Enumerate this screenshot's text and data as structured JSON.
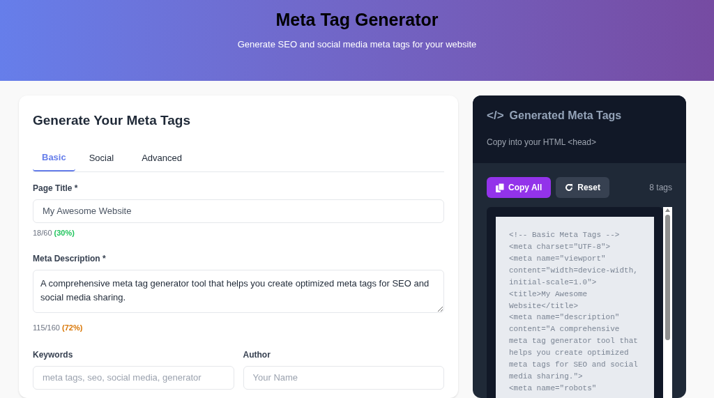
{
  "header": {
    "title": "Meta Tag Generator",
    "subtitle": "Generate SEO and social media meta tags for your website"
  },
  "form": {
    "title": "Generate Your Meta Tags",
    "tabs": [
      {
        "label": "Basic",
        "selected": true
      },
      {
        "label": "Social",
        "selected": false
      },
      {
        "label": "Advanced",
        "selected": false
      }
    ],
    "page_title": {
      "label": "Page Title *",
      "value": "My Awesome Website",
      "count": "18/60",
      "percent": "(30%)",
      "color": "#22c55e"
    },
    "meta_description": {
      "label": "Meta Description *",
      "value": "A comprehensive meta tag generator tool that helps you create optimized meta tags for SEO and social media sharing.",
      "count": "115/160",
      "percent": "(72%)",
      "color": "#d97706"
    },
    "keywords": {
      "label": "Keywords",
      "placeholder": "meta tags, seo, social media, generator"
    },
    "author": {
      "label": "Author",
      "placeholder": "Your Name"
    }
  },
  "output": {
    "icon": "</>",
    "title": "Generated Meta Tags",
    "subtitle": "Copy into your HTML <head>",
    "buttons": [
      {
        "kind": "copy",
        "label": "Copy All"
      },
      {
        "kind": "reset",
        "label": "Reset"
      }
    ],
    "tag_count": "8 tags",
    "code_lines": [
      "<!-- Basic Meta Tags -->",
      "<meta charset=\"UTF-8\">",
      "<meta name=\"viewport\"",
      "content=\"width=device-width,",
      "initial-scale=1.0\">",
      "<title>My Awesome",
      "Website</title>",
      "<meta name=\"description\"",
      "content=\"A comprehensive",
      "meta tag generator tool that",
      "helps you create optimized",
      "meta tags for SEO and social",
      "media sharing.\">",
      "<meta name=\"robots\""
    ]
  }
}
